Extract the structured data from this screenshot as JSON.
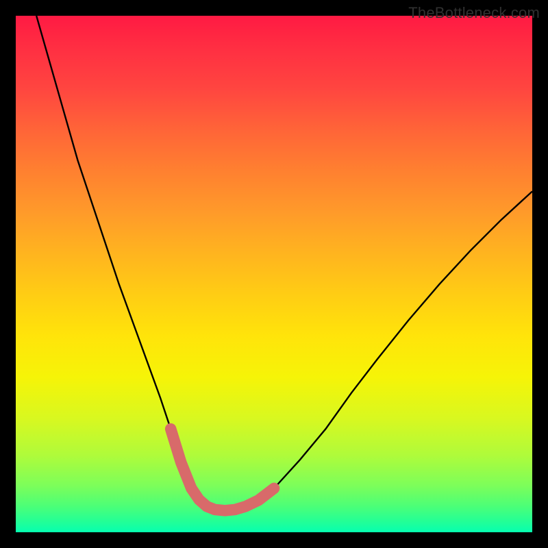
{
  "watermark": "TheBottleneck.com",
  "chart_data": {
    "type": "line",
    "title": "",
    "xlabel": "",
    "ylabel": "",
    "xlim": [
      0,
      100
    ],
    "ylim": [
      0,
      100
    ],
    "grid": false,
    "series": [
      {
        "name": "bottleneck-curve",
        "x": [
          4,
          8,
          12,
          16,
          20,
          24,
          28,
          30,
          32,
          34,
          35.5,
          37,
          38.5,
          40.5,
          42.5,
          44.5,
          47,
          50,
          55,
          60,
          65,
          70,
          76,
          82,
          88,
          94,
          100
        ],
        "values": [
          100,
          86,
          72,
          60,
          48,
          37,
          26,
          20,
          13.5,
          8.5,
          6.3,
          5,
          4.4,
          4.2,
          4.4,
          5,
          6.2,
          8.5,
          14,
          20,
          27,
          33.5,
          41,
          48,
          54.5,
          60.5,
          66
        ]
      },
      {
        "name": "highlight-segment",
        "x": [
          30,
          32,
          34,
          35.5,
          37,
          38.5,
          40.5,
          42.5,
          44.5,
          47,
          50
        ],
        "values": [
          20,
          13.5,
          8.5,
          6.3,
          5,
          4.4,
          4.2,
          4.4,
          5,
          6.2,
          8.5
        ]
      }
    ],
    "colors": {
      "curve": "#000000",
      "highlight": "#D86A6A",
      "gradient_top": "#FF1A43",
      "gradient_bottom": "#05FFB0"
    }
  }
}
